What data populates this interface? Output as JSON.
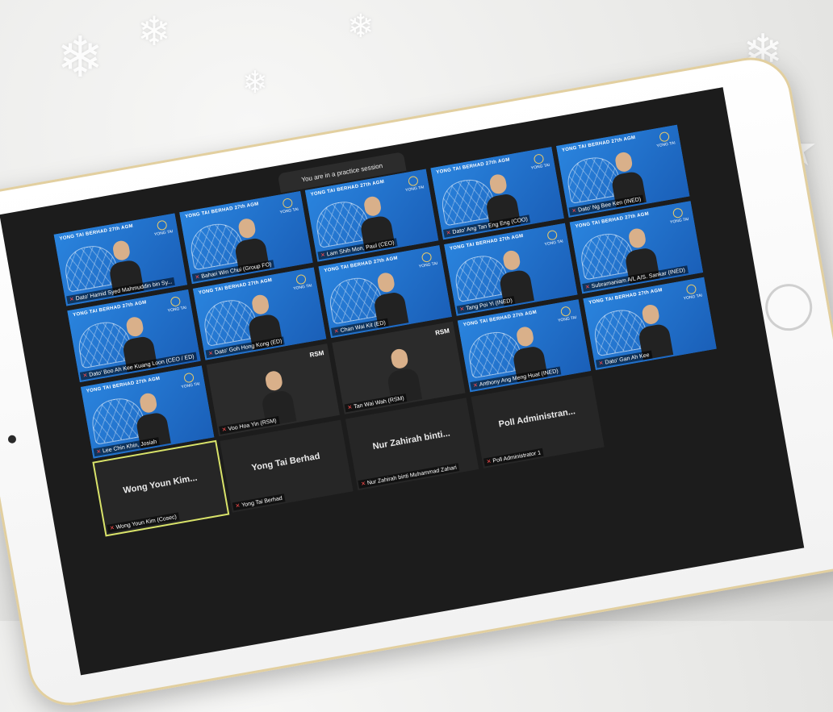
{
  "session_banner": "You are in a practice session",
  "tile_header": "YONG TAI BERHAD 27th AGM",
  "tile_logo": "YONG TAI",
  "rsm_logo": "RSM",
  "participants": [
    {
      "name": "Dato' Hamid Syed Mahmuddin bin Sy...",
      "type": "video"
    },
    {
      "name": "Bahari Win Chui (Group FO)",
      "type": "video"
    },
    {
      "name": "Lam Shih Mon, Paul (CEO)",
      "type": "video"
    },
    {
      "name": "Dato' Ang Tan Eng Eng (COO)",
      "type": "video"
    },
    {
      "name": "Dato' Ng Bee Ken (INED)",
      "type": "video"
    },
    {
      "name": "Dato' Boo Ah Kee Kuang Loon (CEO / ED)",
      "type": "video"
    },
    {
      "name": "Dato' Goh Hong Kong (ED)",
      "type": "video"
    },
    {
      "name": "Chan Wai Kit (ED)",
      "type": "video"
    },
    {
      "name": "Tang Poi Yi (INED)",
      "type": "video"
    },
    {
      "name": "Subramaniam A/L A/S. Sankar (INED)",
      "type": "video"
    },
    {
      "name": "Lee Chin Khin, Josiah",
      "type": "video"
    },
    {
      "name": "Voo Hoa Yin (RSM)",
      "type": "rsm"
    },
    {
      "name": "Tan Wai Wah (RSM)",
      "type": "rsm"
    },
    {
      "name": "Anthony Ang Meng Huat (INED)",
      "type": "video"
    },
    {
      "name": "Dato' Gan Ah Kee",
      "type": "video"
    },
    {
      "name": "Wong Youn Kim (Cosec)",
      "display": "Wong Youn Kim...",
      "type": "placeholder"
    },
    {
      "name": "Yong Tai Berhad",
      "display": "Yong Tai Berhad",
      "type": "placeholder"
    },
    {
      "name": "Nur Zahirah binti Muhammad Zahari",
      "display": "Nur Zahirah binti...",
      "type": "placeholder"
    },
    {
      "name": "Poll Administrator 1",
      "display": "Poll Administran...",
      "type": "placeholder"
    }
  ]
}
